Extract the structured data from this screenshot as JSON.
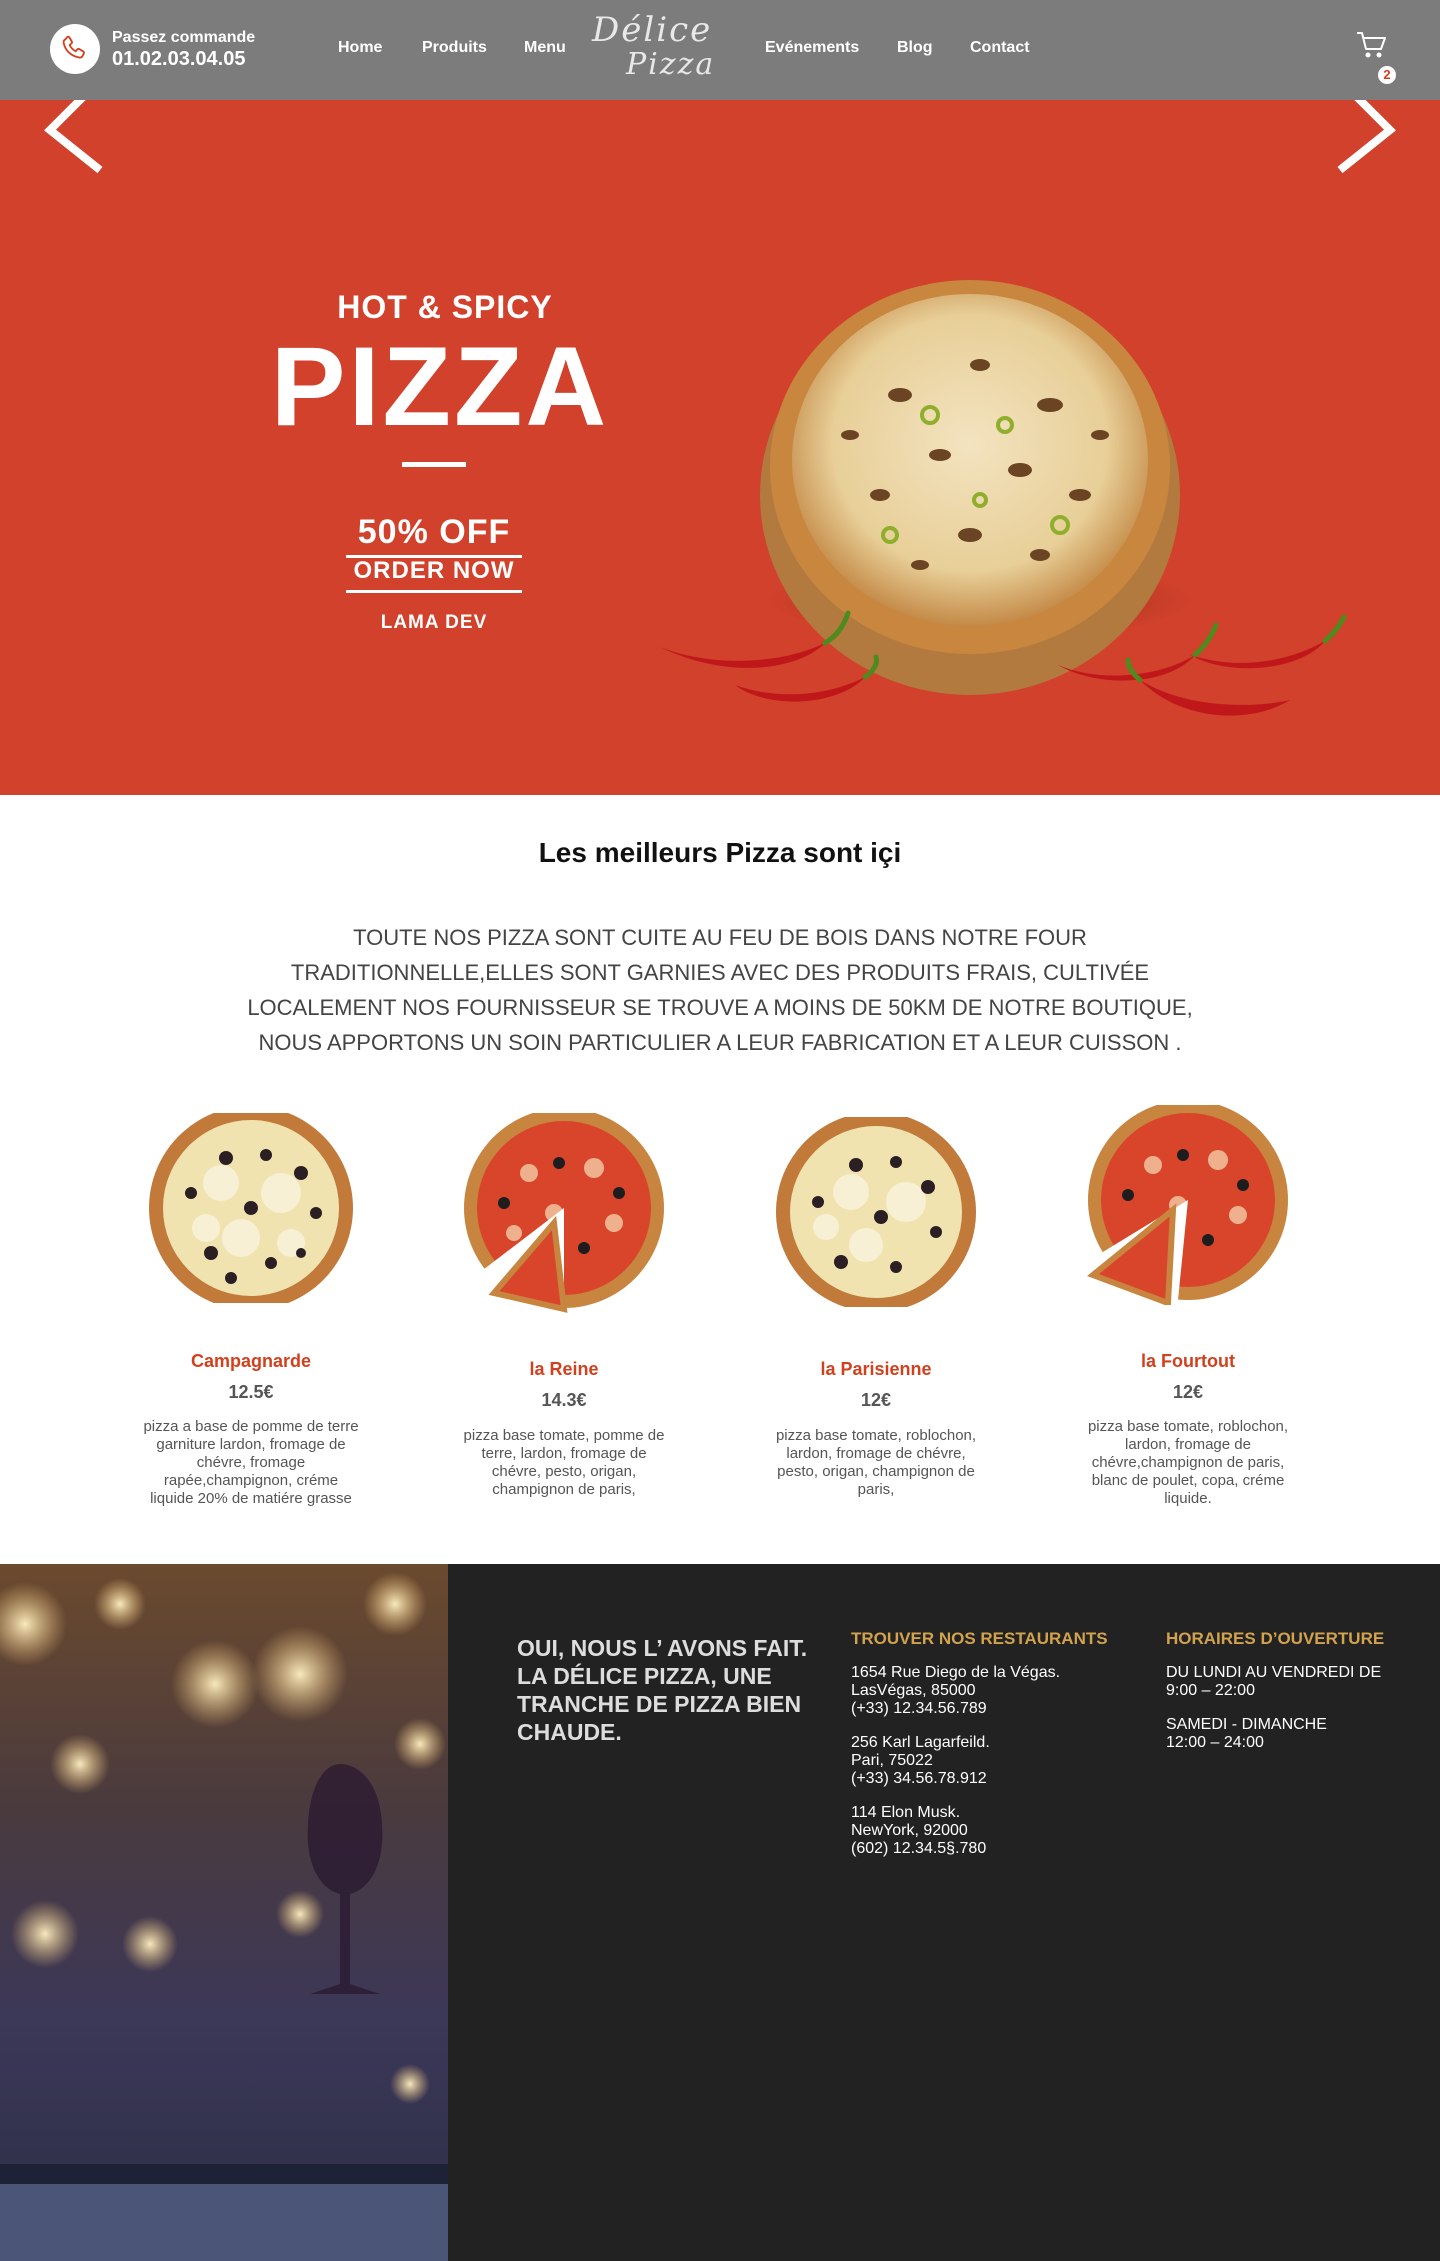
{
  "navbar": {
    "call_label": "Passez commande",
    "phone": "01.02.03.04.05",
    "links": [
      "Home",
      "Produits",
      "Menu",
      "Evénements",
      "Blog",
      "Contact"
    ],
    "logo_line1": "Délice",
    "logo_line2": "Pizza",
    "cart_count": "2",
    "icons": [
      "phone-icon",
      "cart-icon"
    ]
  },
  "hero": {
    "subtitle": "HOT & SPICY",
    "title": "PIZZA",
    "offer": "50% OFF",
    "cta": "ORDER NOW",
    "brand": "LAMA DEV",
    "icons": [
      "arrow-left-icon",
      "arrow-right-icon"
    ]
  },
  "intro": {
    "title": "Les meilleurs Pizza sont içi",
    "description": "TOUTE NOS PIZZA SONT CUITE AU FEU DE BOIS DANS NOTRE FOUR TRADITIONNELLE,ELLES SONT GARNIES AVEC DES PRODUITS FRAIS, CULTIVÉE LOCALEMENT NOS FOURNISSEUR SE TROUVE A MOINS DE 50KM DE NOTRE BOUTIQUE, NOUS APPORTONS UN SOIN PARTICULIER A LEUR FABRICATION ET A LEUR CUISSON ."
  },
  "products": [
    {
      "name": "Campagnarde",
      "price": "12.5€",
      "description": "pizza a base de pomme de terre garniture lardon, fromage de chévre, fromage rapée,champignon, créme liquide 20% de matiére grasse"
    },
    {
      "name": "la Reine",
      "price": "14.3€",
      "description": "pizza base tomate, pomme de terre, lardon, fromage de chévre, pesto, origan, champignon de paris,"
    },
    {
      "name": "la Parisienne",
      "price": "12€",
      "description": "pizza base tomate, roblochon, lardon, fromage de chévre, pesto, origan, champignon de paris,"
    },
    {
      "name": "la Fourtout",
      "price": "12€",
      "description": "pizza base tomate, roblochon, lardon, fromage de chévre,champignon de paris, blanc de poulet, copa, créme liquide."
    }
  ],
  "footer": {
    "motto": "OUI, NOUS L’ AVONS FAIT. LA DÉLICE PIZZA, UNE TRANCHE DE PIZZA BIEN CHAUDE.",
    "restaurants_title": "TROUVER NOS RESTAURANTS",
    "restaurants": [
      {
        "line1": "1654 Rue Diego de la Végas.",
        "line2": "LasVégas, 85000",
        "line3": "(+33) 12.34.56.789"
      },
      {
        "line1": "256 Karl Lagarfeild.",
        "line2": "Pari, 75022",
        "line3": "(+33) 34.56.78.912"
      },
      {
        "line1": "114 Elon Musk.",
        "line2": "NewYork, 92000",
        "line3": "(602) 12.34.5§.780"
      }
    ],
    "hours_title": "HORAIRES D’OUVERTURE",
    "hours": [
      {
        "days": "DU LUNDI AU VENDREDI DE",
        "time": "9:00 – 22:00"
      },
      {
        "days": "SAMEDI - DIMANCHE",
        "time": "12:00 – 24:00"
      }
    ]
  },
  "colors": {
    "navbar": "#7c7c7c",
    "hero_bg": "#d1412b",
    "accent": "#d1411e",
    "footer_bg": "#222222",
    "footer_heading": "#d2a24c"
  }
}
